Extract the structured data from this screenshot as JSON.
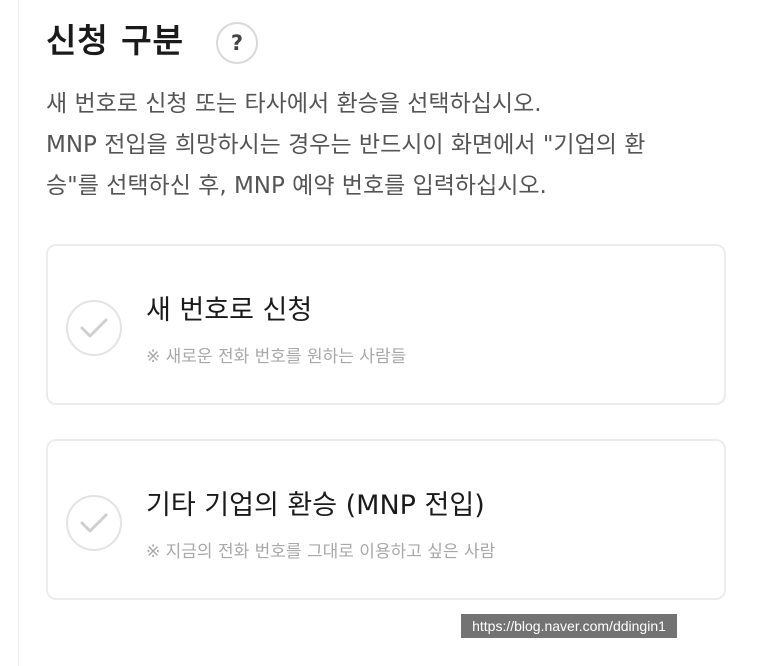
{
  "section": {
    "title": "신청 구분",
    "help_label": "?"
  },
  "description": {
    "lines": [
      "새 번호로 신청 또는 타사에서 환승을 선택하십시오.",
      "MNP 전입을 희망하시는 경우는 반드시이 화면에서 \"기업의 환",
      "승\"를 선택하신 후, MNP 예약 번호를 입력하십시오."
    ]
  },
  "options": [
    {
      "title": "새 번호로 신청",
      "subtitle": "※ 새로운 전화 번호를 원하는 사람들",
      "selected": false
    },
    {
      "title": "기타 기업의 환승 (MNP 전입)",
      "subtitle": "※ 지금의 전화 번호를 그대로 이용하고 싶은 사람",
      "selected": false
    }
  ],
  "icons": {
    "help": "question-mark-icon",
    "option_check": "check-circle-icon"
  },
  "colors": {
    "title": "#1a1a1a",
    "body_text": "#555555",
    "subtext": "#a8a8a8",
    "border": "#ececec",
    "check": "#cfcfcf"
  },
  "watermark": {
    "text": "https://blog.naver.com/ddingin1"
  }
}
